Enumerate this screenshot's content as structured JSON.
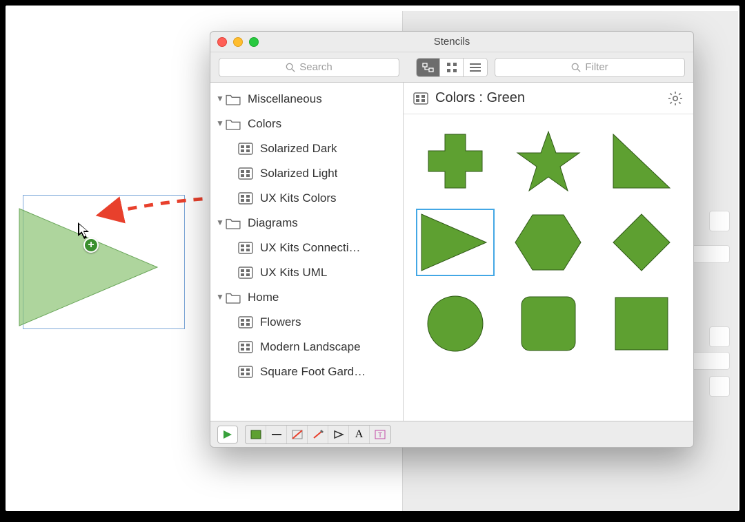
{
  "window": {
    "title": "Stencils",
    "search_placeholder": "Search",
    "filter_placeholder": "Filter"
  },
  "sidebar": {
    "folders": [
      {
        "label": "Miscellaneous",
        "items": []
      },
      {
        "label": "Colors",
        "items": [
          {
            "label": "Solarized Dark"
          },
          {
            "label": "Solarized Light"
          },
          {
            "label": "UX Kits Colors"
          }
        ]
      },
      {
        "label": "Diagrams",
        "items": [
          {
            "label": "UX Kits Connecti…"
          },
          {
            "label": "UX Kits UML"
          }
        ]
      },
      {
        "label": "Home",
        "items": [
          {
            "label": "Flowers"
          },
          {
            "label": "Modern Landscape"
          },
          {
            "label": "Square Foot Gard…"
          }
        ]
      }
    ]
  },
  "detail": {
    "title": "Colors : Green",
    "shapes": [
      {
        "name": "plus-shape"
      },
      {
        "name": "star-shape"
      },
      {
        "name": "right-triangle-shape"
      },
      {
        "name": "play-triangle-shape",
        "selected": true
      },
      {
        "name": "hexagon-shape"
      },
      {
        "name": "diamond-shape"
      },
      {
        "name": "circle-shape"
      },
      {
        "name": "rounded-square-shape"
      },
      {
        "name": "square-shape"
      }
    ]
  },
  "colors": {
    "shape_fill": "#5ea031",
    "shape_stroke": "#2f5917",
    "ghost_fill": "rgba(130,190,105,0.65)"
  },
  "toolbar": {
    "views": [
      "hierarchy-view",
      "grid-view",
      "list-view"
    ]
  },
  "statusbar": {
    "letter_a": "A"
  }
}
